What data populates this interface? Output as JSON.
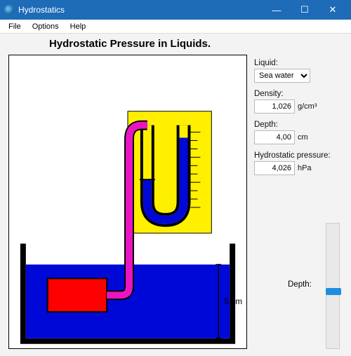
{
  "window": {
    "title": "Hydrostatics",
    "minimize": "—",
    "maximize": "☐",
    "close": "✕"
  },
  "menu": {
    "file": "File",
    "options": "Options",
    "help": "Help"
  },
  "heading": "Hydrostatic Pressure in Liquids.",
  "panel": {
    "liquid_label": "Liquid:",
    "liquid_value": "Sea water",
    "density_label": "Density:",
    "density_value": "1,026",
    "density_unit": "g/cm³",
    "depth_label": "Depth:",
    "depth_value": "4,00",
    "depth_unit": "cm",
    "pressure_label": "Hydrostatic pressure:",
    "pressure_value": "4,026",
    "pressure_unit": "hPa"
  },
  "slider": {
    "label": "Depth:"
  },
  "diagram": {
    "scale_label": "5 cm"
  },
  "colors": {
    "tank_outline": "#000",
    "liquid": "#0008d8",
    "tube": "#e815c0",
    "gauge_bg": "#fff000",
    "gauge_fluid": "#0008d8",
    "sensor_box": "#ff0000"
  }
}
